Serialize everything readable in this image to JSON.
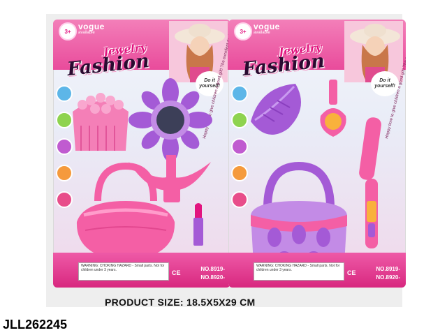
{
  "cards": [
    {
      "age_label": "3+",
      "age_sub": "years",
      "brand": "vogue",
      "brand_sub": "available",
      "title_top": "Jewelry",
      "title_main": "Fashion",
      "badge": "Do it yourself!",
      "slogan": "Happy time to give children a good gift! The excellent design special for your children.",
      "warning": "WARNING: CHOKING HAZARD - Small parts. Not for children under 3 years.",
      "cert": "CE",
      "model_no_1": "NO.8919-",
      "model_no_2": "NO.8920-"
    },
    {
      "age_label": "3+",
      "age_sub": "years",
      "brand": "vogue",
      "brand_sub": "available",
      "title_top": "Jewelry",
      "title_main": "Fashion",
      "badge": "Do it yourself!",
      "slogan": "Happy time to give children a good gift! The excellent design special for your children.",
      "warning": "WARNING: CHOKING HAZARD - Small parts. Not for children under 3 years.",
      "cert": "CE",
      "model_no_1": "NO.8919-",
      "model_no_2": "NO.8920-"
    }
  ],
  "caption": "PRODUCT SIZE:  18.5X5X29 CM",
  "product_code": "JLL262245",
  "colors": {
    "card_pink": "#e94b9b",
    "toy_pink": "#f45fa5",
    "toy_purple": "#a45ad6",
    "title_dark": "#2a0a30"
  }
}
